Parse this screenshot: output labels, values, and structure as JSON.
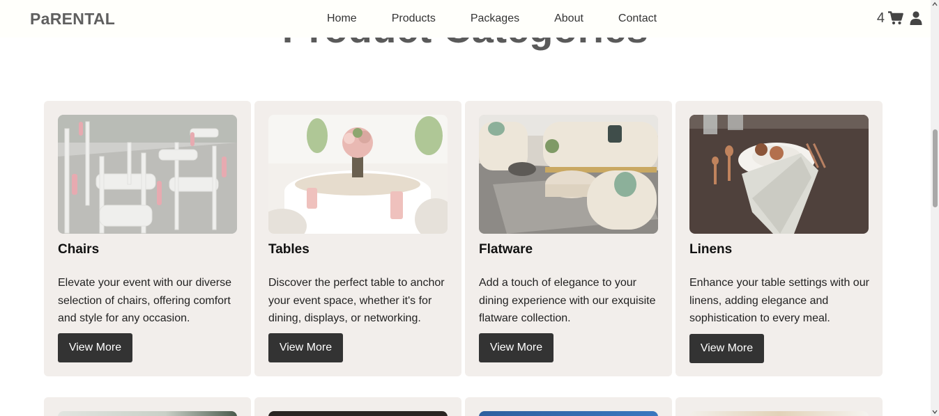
{
  "navbar": {
    "brand": "PaRENTAL",
    "links": [
      "Home",
      "Products",
      "Packages",
      "About",
      "Contact"
    ],
    "cart_count": "4",
    "icons": [
      "cart-icon",
      "user-icon"
    ]
  },
  "section": {
    "heading": "Product Categories"
  },
  "categories": [
    {
      "title": "Chairs",
      "description": "Elevate your event with our diverse selection of chairs, offering comfort and style for any occasion.",
      "button": "View More",
      "image": "white-chairs-photo"
    },
    {
      "title": "Tables",
      "description": "Discover the perfect table to anchor your event space, whether it's for dining, displays, or networking.",
      "button": "View More",
      "image": "banquet-table-photo"
    },
    {
      "title": "Flatware",
      "description": "Add a touch of elegance to your dining experience with our exquisite flatware collection.",
      "button": "View More",
      "image": "lounge-furniture-photo"
    },
    {
      "title": "Linens",
      "description": "Enhance your table settings with our linens, adding elegance and sophistication to every meal.",
      "button": "View More",
      "image": "table-linen-photo"
    }
  ],
  "colors": {
    "card_bg": "#f2eeeb",
    "button_bg": "#333333",
    "brand_text": "#5f5f5f"
  }
}
